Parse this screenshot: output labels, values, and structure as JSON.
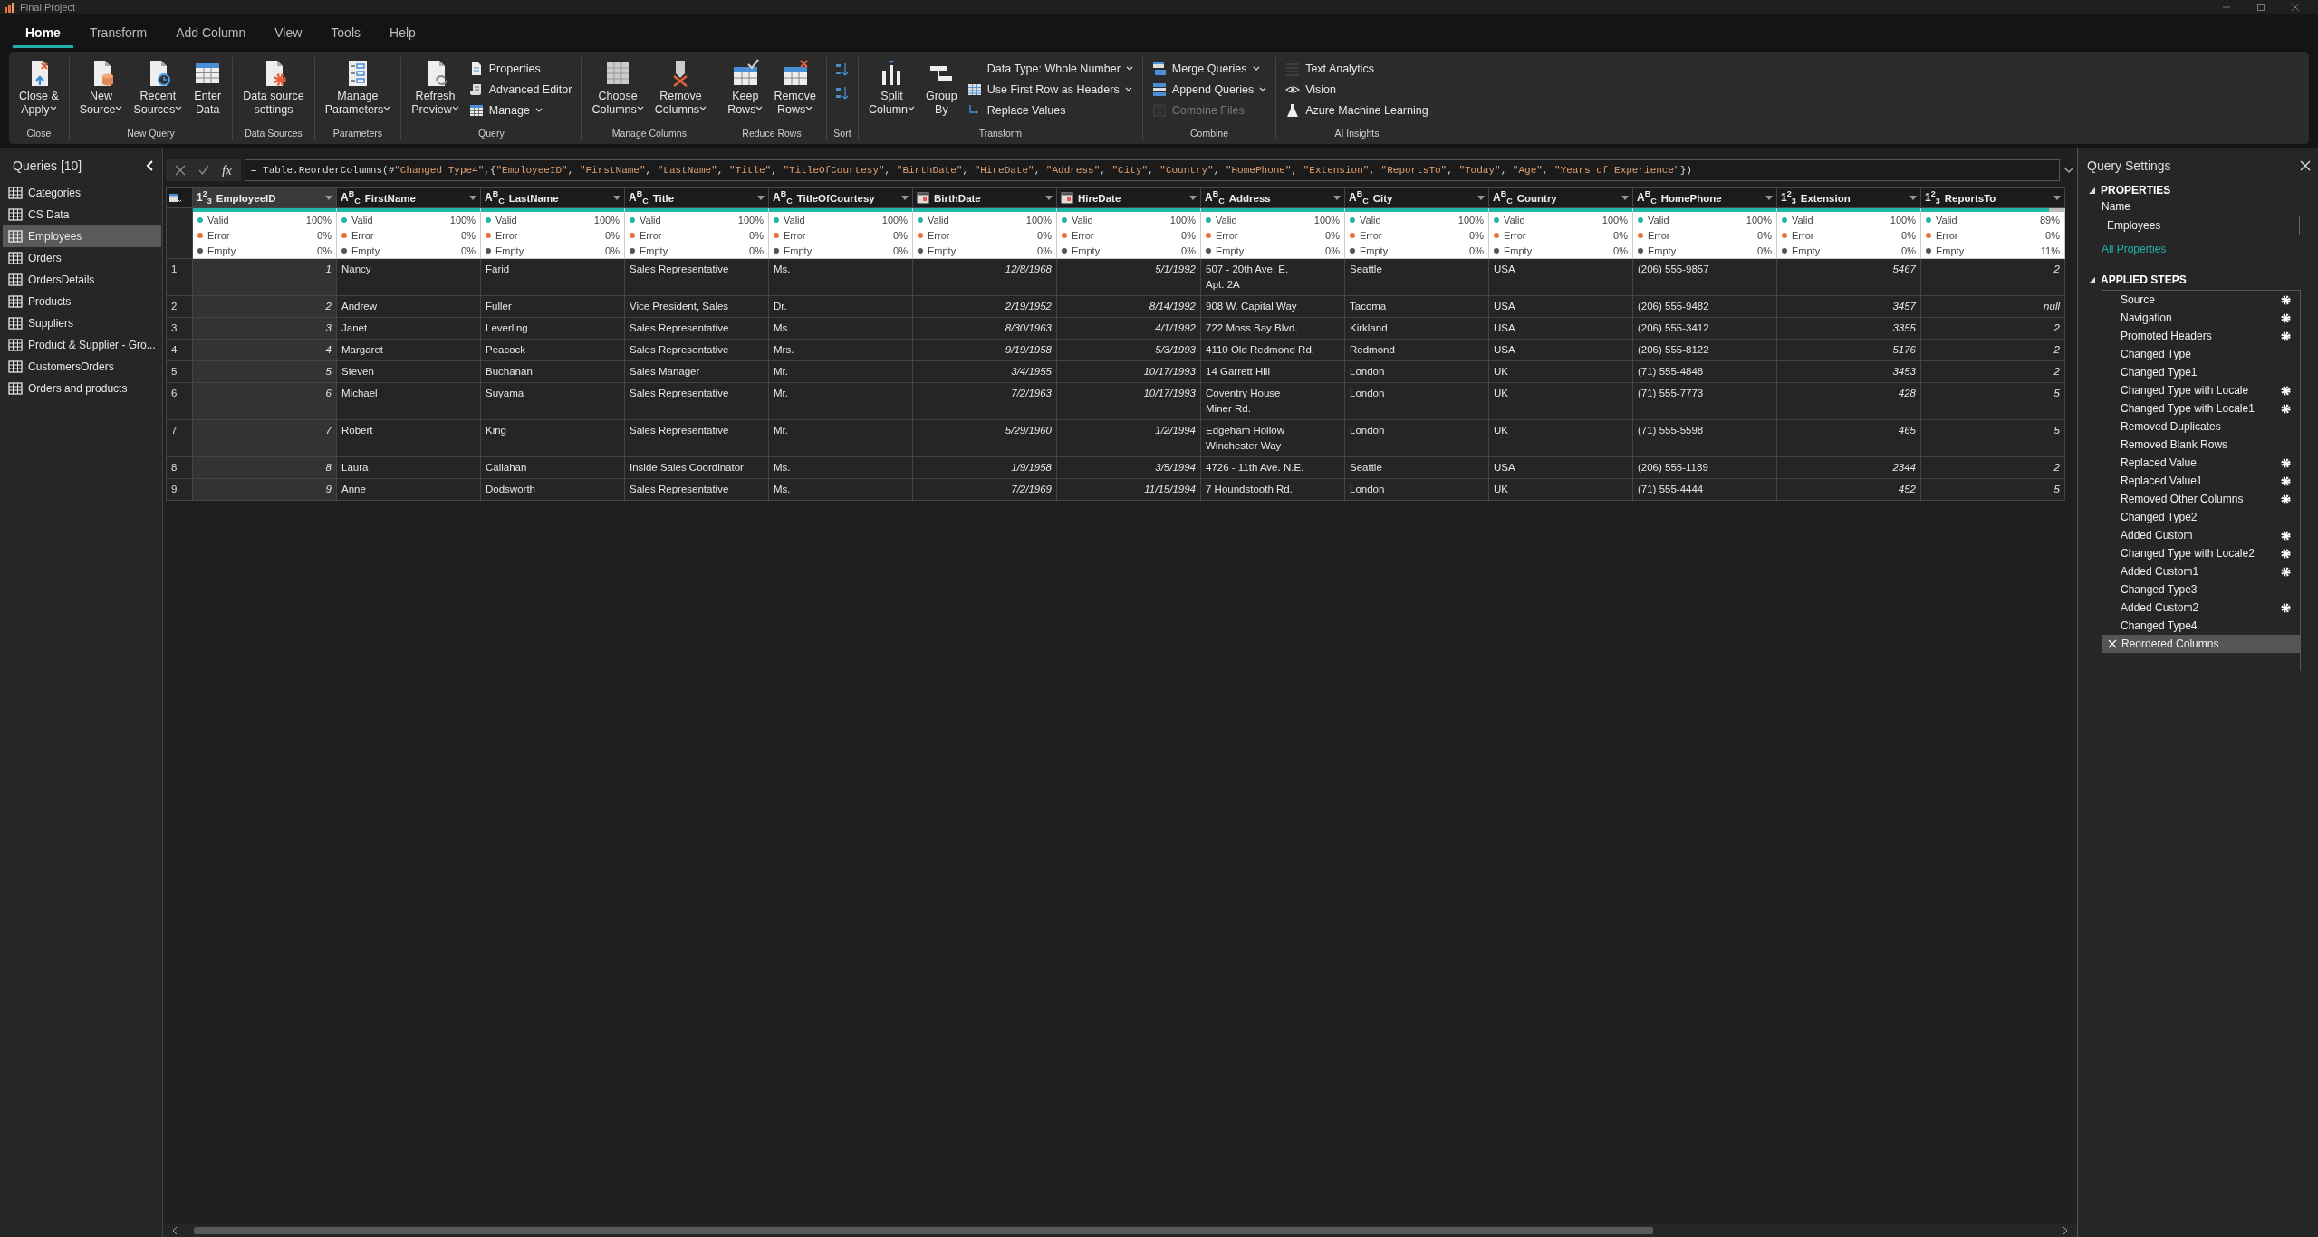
{
  "window": {
    "title": "Final Project"
  },
  "menu_tabs": [
    {
      "label": "Home",
      "selected": true
    },
    {
      "label": "Transform",
      "selected": false
    },
    {
      "label": "Add Column",
      "selected": false
    },
    {
      "label": "View",
      "selected": false
    },
    {
      "label": "Tools",
      "selected": false
    },
    {
      "label": "Help",
      "selected": false
    }
  ],
  "ribbon": {
    "groups": [
      {
        "label": "Close",
        "items": [
          {
            "kind": "large",
            "label": "Close &\nApply",
            "dropdown": true,
            "disabled": false
          }
        ]
      },
      {
        "label": "New Query",
        "items": [
          {
            "kind": "large",
            "label": "New\nSource",
            "dropdown": true,
            "disabled": false
          },
          {
            "kind": "large",
            "label": "Recent\nSources",
            "dropdown": true,
            "disabled": false
          },
          {
            "kind": "large",
            "label": "Enter\nData",
            "dropdown": false,
            "disabled": false
          }
        ]
      },
      {
        "label": "Data Sources",
        "items": [
          {
            "kind": "large",
            "label": "Data source\nsettings",
            "dropdown": false,
            "disabled": false
          }
        ]
      },
      {
        "label": "Parameters",
        "items": [
          {
            "kind": "large",
            "label": "Manage\nParameters",
            "dropdown": true,
            "disabled": false
          }
        ]
      },
      {
        "label": "Query",
        "items": [
          {
            "kind": "large",
            "label": "Refresh\nPreview",
            "dropdown": true,
            "disabled": false
          },
          {
            "kind": "small",
            "label": "Properties",
            "dropdown": false,
            "disabled": false
          },
          {
            "kind": "small",
            "label": "Advanced Editor",
            "dropdown": false,
            "disabled": false
          },
          {
            "kind": "small",
            "label": "Manage",
            "dropdown": true,
            "disabled": false
          }
        ]
      },
      {
        "label": "Manage Columns",
        "items": [
          {
            "kind": "large",
            "label": "Choose\nColumns",
            "dropdown": true,
            "disabled": false
          },
          {
            "kind": "large",
            "label": "Remove\nColumns",
            "dropdown": true,
            "disabled": false
          }
        ]
      },
      {
        "label": "Reduce Rows",
        "items": [
          {
            "kind": "large",
            "label": "Keep\nRows",
            "dropdown": true,
            "disabled": false
          },
          {
            "kind": "large",
            "label": "Remove\nRows",
            "dropdown": true,
            "disabled": false
          }
        ]
      },
      {
        "label": "Sort",
        "items": [
          {
            "kind": "icon",
            "dropdown": false,
            "disabled": false
          },
          {
            "kind": "icon",
            "dropdown": false,
            "disabled": false
          }
        ]
      },
      {
        "label": "Transform",
        "items": [
          {
            "kind": "large",
            "label": "Split\nColumn",
            "dropdown": true,
            "disabled": false
          },
          {
            "kind": "large",
            "label": "Group\nBy",
            "dropdown": false,
            "disabled": false
          },
          {
            "kind": "small",
            "label": "Data Type: Whole Number",
            "dropdown": true,
            "disabled": false
          },
          {
            "kind": "small",
            "label": "Use First Row as Headers",
            "dropdown": true,
            "disabled": false
          },
          {
            "kind": "small",
            "label": "Replace Values",
            "dropdown": false,
            "disabled": false
          }
        ]
      },
      {
        "label": "Combine",
        "items": [
          {
            "kind": "small",
            "label": "Merge Queries",
            "dropdown": true,
            "disabled": false
          },
          {
            "kind": "small",
            "label": "Append Queries",
            "dropdown": true,
            "disabled": false
          },
          {
            "kind": "small",
            "label": "Combine Files",
            "dropdown": false,
            "disabled": true
          }
        ]
      },
      {
        "label": "AI Insights",
        "items": [
          {
            "kind": "small",
            "label": "Text Analytics",
            "dropdown": false,
            "disabled": false
          },
          {
            "kind": "small",
            "label": "Vision",
            "dropdown": false,
            "disabled": false
          },
          {
            "kind": "small",
            "label": "Azure Machine Learning",
            "dropdown": false,
            "disabled": false
          }
        ]
      }
    ]
  },
  "queries": {
    "title": "Queries [10]",
    "items": [
      {
        "label": "Categories",
        "selected": false
      },
      {
        "label": "CS Data",
        "selected": false
      },
      {
        "label": "Employees",
        "selected": true
      },
      {
        "label": "Orders",
        "selected": false
      },
      {
        "label": "OrdersDetails",
        "selected": false
      },
      {
        "label": "Products",
        "selected": false
      },
      {
        "label": "Suppliers",
        "selected": false
      },
      {
        "label": "Product & Supplier - Gro...",
        "selected": false
      },
      {
        "label": "CustomersOrders",
        "selected": false
      },
      {
        "label": "Orders and products",
        "selected": false
      }
    ]
  },
  "formula_bar": {
    "fx_label": "fx",
    "formula": "= Table.ReorderColumns(#\"Changed Type4\",{\"EmployeeID\", \"FirstName\", \"LastName\", \"Title\", \"TitleOfCourtesy\", \"BirthDate\", \"HireDate\", \"Address\", \"City\", \"Country\", \"HomePhone\", \"Extension\", \"ReportsTo\", \"Today\", \"Age\", \"Years of Experience\"})"
  },
  "table": {
    "columns": [
      {
        "name": "EmployeeID",
        "kind": "number",
        "type_label": "1$^{2}$$_{3}$",
        "selected": true,
        "level": 1,
        "quality": [
          {
            "label": "Valid",
            "value": "100%",
            "color": "#1fb8a8"
          },
          {
            "label": "Error",
            "value": "0%",
            "color": "#e8703c"
          },
          {
            "label": "Empty",
            "value": "0%",
            "color": "#555555"
          }
        ]
      },
      {
        "name": "FirstName",
        "kind": "text",
        "type_label": "A$^{B}$$_{C}$",
        "selected": false,
        "level": 1,
        "quality": [
          {
            "label": "Valid",
            "value": "100%",
            "color": "#1fb8a8"
          },
          {
            "label": "Error",
            "value": "0%",
            "color": "#e8703c"
          },
          {
            "label": "Empty",
            "value": "0%",
            "color": "#555555"
          }
        ]
      },
      {
        "name": "LastName",
        "kind": "text",
        "type_label": "A$^{B}$$_{C}$",
        "selected": false,
        "level": 1,
        "quality": [
          {
            "label": "Valid",
            "value": "100%",
            "color": "#1fb8a8"
          },
          {
            "label": "Error",
            "value": "0%",
            "color": "#e8703c"
          },
          {
            "label": "Empty",
            "value": "0%",
            "color": "#555555"
          }
        ]
      },
      {
        "name": "Title",
        "kind": "text",
        "type_label": "A$^{B}$$_{C}$",
        "selected": false,
        "level": 1,
        "quality": [
          {
            "label": "Valid",
            "value": "100%",
            "color": "#1fb8a8"
          },
          {
            "label": "Error",
            "value": "0%",
            "color": "#e8703c"
          },
          {
            "label": "Empty",
            "value": "0%",
            "color": "#555555"
          }
        ]
      },
      {
        "name": "TitleOfCourtesy",
        "kind": "text",
        "type_label": "A$^{B}$$_{C}$",
        "selected": false,
        "level": 1,
        "quality": [
          {
            "label": "Valid",
            "value": "100%",
            "color": "#1fb8a8"
          },
          {
            "label": "Error",
            "value": "0%",
            "color": "#e8703c"
          },
          {
            "label": "Empty",
            "value": "0%",
            "color": "#555555"
          }
        ]
      },
      {
        "name": "BirthDate",
        "kind": "date",
        "selected": false,
        "level": 1,
        "quality": [
          {
            "label": "Valid",
            "value": "100%",
            "color": "#1fb8a8"
          },
          {
            "label": "Error",
            "value": "0%",
            "color": "#e8703c"
          },
          {
            "label": "Empty",
            "value": "0%",
            "color": "#555555"
          }
        ]
      },
      {
        "name": "HireDate",
        "kind": "date",
        "selected": false,
        "level": 1,
        "quality": [
          {
            "label": "Valid",
            "value": "100%",
            "color": "#1fb8a8"
          },
          {
            "label": "Error",
            "value": "0%",
            "color": "#e8703c"
          },
          {
            "label": "Empty",
            "value": "0%",
            "color": "#555555"
          }
        ]
      },
      {
        "name": "Address",
        "kind": "text",
        "type_label": "A$^{B}$$_{C}$",
        "selected": false,
        "level": 1,
        "quality": [
          {
            "label": "Valid",
            "value": "100%",
            "color": "#1fb8a8"
          },
          {
            "label": "Error",
            "value": "0%",
            "color": "#e8703c"
          },
          {
            "label": "Empty",
            "value": "0%",
            "color": "#555555"
          }
        ]
      },
      {
        "name": "City",
        "kind": "text",
        "type_label": "A$^{B}$$_{C}$",
        "selected": false,
        "level": 1,
        "quality": [
          {
            "label": "Valid",
            "value": "100%",
            "color": "#1fb8a8"
          },
          {
            "label": "Error",
            "value": "0%",
            "color": "#e8703c"
          },
          {
            "label": "Empty",
            "value": "0%",
            "color": "#555555"
          }
        ]
      },
      {
        "name": "Country",
        "kind": "text",
        "type_label": "A$^{B}$$_{C}$",
        "selected": false,
        "level": 1,
        "quality": [
          {
            "label": "Valid",
            "value": "100%",
            "color": "#1fb8a8"
          },
          {
            "label": "Error",
            "value": "0%",
            "color": "#e8703c"
          },
          {
            "label": "Empty",
            "value": "0%",
            "color": "#555555"
          }
        ]
      },
      {
        "name": "HomePhone",
        "kind": "text",
        "type_label": "A$^{B}$$_{C}$",
        "selected": false,
        "level": 1,
        "quality": [
          {
            "label": "Valid",
            "value": "100%",
            "color": "#1fb8a8"
          },
          {
            "label": "Error",
            "value": "0%",
            "color": "#e8703c"
          },
          {
            "label": "Empty",
            "value": "0%",
            "color": "#555555"
          }
        ]
      },
      {
        "name": "Extension",
        "kind": "number",
        "type_label": "1$^{2}$$_{3}$",
        "selected": false,
        "level": 1,
        "quality": [
          {
            "label": "Valid",
            "value": "100%",
            "color": "#1fb8a8"
          },
          {
            "label": "Error",
            "value": "0%",
            "color": "#e8703c"
          },
          {
            "label": "Empty",
            "value": "0%",
            "color": "#555555"
          }
        ]
      },
      {
        "name": "ReportsTo",
        "kind": "number",
        "type_label": "1$^{2}$$_{3}$",
        "selected": false,
        "level": 0.89,
        "quality": [
          {
            "label": "Valid",
            "value": "89%",
            "color": "#1fb8a8"
          },
          {
            "label": "Error",
            "value": "0%",
            "color": "#e8703c"
          },
          {
            "label": "Empty",
            "value": "11%",
            "color": "#555555"
          }
        ]
      }
    ],
    "rows": [
      {
        "number": "1",
        "cells": [
          "1",
          "Nancy",
          "Farid",
          "Sales Representative",
          "Ms.",
          "12/8/1968",
          "5/1/1992",
          "507 - 20th Ave. E.\nApt. 2A",
          "Seattle",
          "USA",
          "(206) 555-9857",
          "5467",
          "2"
        ]
      },
      {
        "number": "2",
        "cells": [
          "2",
          "Andrew",
          "Fuller",
          "Vice President, Sales",
          "Dr.",
          "2/19/1952",
          "8/14/1992",
          "908 W. Capital Way",
          "Tacoma",
          "USA",
          "(206) 555-9482",
          "3457",
          "null"
        ]
      },
      {
        "number": "3",
        "cells": [
          "3",
          "Janet",
          "Leverling",
          "Sales Representative",
          "Ms.",
          "8/30/1963",
          "4/1/1992",
          "722 Moss Bay Blvd.",
          "Kirkland",
          "USA",
          "(206) 555-3412",
          "3355",
          "2"
        ]
      },
      {
        "number": "4",
        "cells": [
          "4",
          "Margaret",
          "Peacock",
          "Sales Representative",
          "Mrs.",
          "9/19/1958",
          "5/3/1993",
          "4110 Old Redmond Rd.",
          "Redmond",
          "USA",
          "(206) 555-8122",
          "5176",
          "2"
        ]
      },
      {
        "number": "5",
        "cells": [
          "5",
          "Steven",
          "Buchanan",
          "Sales Manager",
          "Mr.",
          "3/4/1955",
          "10/17/1993",
          "14 Garrett Hill",
          "London",
          "UK",
          "(71) 555-4848",
          "3453",
          "2"
        ]
      },
      {
        "number": "6",
        "cells": [
          "6",
          "Michael",
          "Suyama",
          "Sales Representative",
          "Mr.",
          "7/2/1963",
          "10/17/1993",
          "Coventry House\nMiner Rd.",
          "London",
          "UK",
          "(71) 555-7773",
          "428",
          "5"
        ]
      },
      {
        "number": "7",
        "cells": [
          "7",
          "Robert",
          "King",
          "Sales Representative",
          "Mr.",
          "5/29/1960",
          "1/2/1994",
          "Edgeham Hollow\nWinchester Way",
          "London",
          "UK",
          "(71) 555-5598",
          "465",
          "5"
        ]
      },
      {
        "number": "8",
        "cells": [
          "8",
          "Laura",
          "Callahan",
          "Inside Sales Coordinator",
          "Ms.",
          "1/9/1958",
          "3/5/1994",
          "4726 - 11th Ave. N.E.",
          "Seattle",
          "USA",
          "(206) 555-1189",
          "2344",
          "2"
        ]
      },
      {
        "number": "9",
        "cells": [
          "9",
          "Anne",
          "Dodsworth",
          "Sales Representative",
          "Ms.",
          "7/2/1969",
          "11/15/1994",
          "7 Houndstooth Rd.",
          "London",
          "UK",
          "(71) 555-4444",
          "452",
          "5"
        ]
      }
    ]
  },
  "query_settings": {
    "title": "Query Settings",
    "properties": {
      "heading": "PROPERTIES",
      "expanded": true,
      "name_label": "Name",
      "name_value": "Employees",
      "link": "All Properties"
    },
    "applied_steps": {
      "heading": "APPLIED STEPS",
      "expanded": true,
      "steps": [
        {
          "label": "Source",
          "gear": true,
          "selected": false
        },
        {
          "label": "Navigation",
          "gear": true,
          "selected": false
        },
        {
          "label": "Promoted Headers",
          "gear": true,
          "selected": false
        },
        {
          "label": "Changed Type",
          "gear": false,
          "selected": false
        },
        {
          "label": "Changed Type1",
          "gear": false,
          "selected": false
        },
        {
          "label": "Changed Type with Locale",
          "gear": true,
          "selected": false
        },
        {
          "label": "Changed Type with Locale1",
          "gear": true,
          "selected": false
        },
        {
          "label": "Removed Duplicates",
          "gear": false,
          "selected": false
        },
        {
          "label": "Removed Blank Rows",
          "gear": false,
          "selected": false
        },
        {
          "label": "Replaced Value",
          "gear": true,
          "selected": false
        },
        {
          "label": "Replaced Value1",
          "gear": true,
          "selected": false
        },
        {
          "label": "Removed Other Columns",
          "gear": true,
          "selected": false
        },
        {
          "label": "Changed Type2",
          "gear": false,
          "selected": false
        },
        {
          "label": "Added Custom",
          "gear": true,
          "selected": false
        },
        {
          "label": "Changed Type with Locale2",
          "gear": true,
          "selected": false
        },
        {
          "label": "Added Custom1",
          "gear": true,
          "selected": false
        },
        {
          "label": "Changed Type3",
          "gear": false,
          "selected": false
        },
        {
          "label": "Added Custom2",
          "gear": true,
          "selected": false
        },
        {
          "label": "Changed Type4",
          "gear": false,
          "selected": false
        },
        {
          "label": "Reordered Columns",
          "gear": false,
          "selected": true
        }
      ]
    }
  }
}
